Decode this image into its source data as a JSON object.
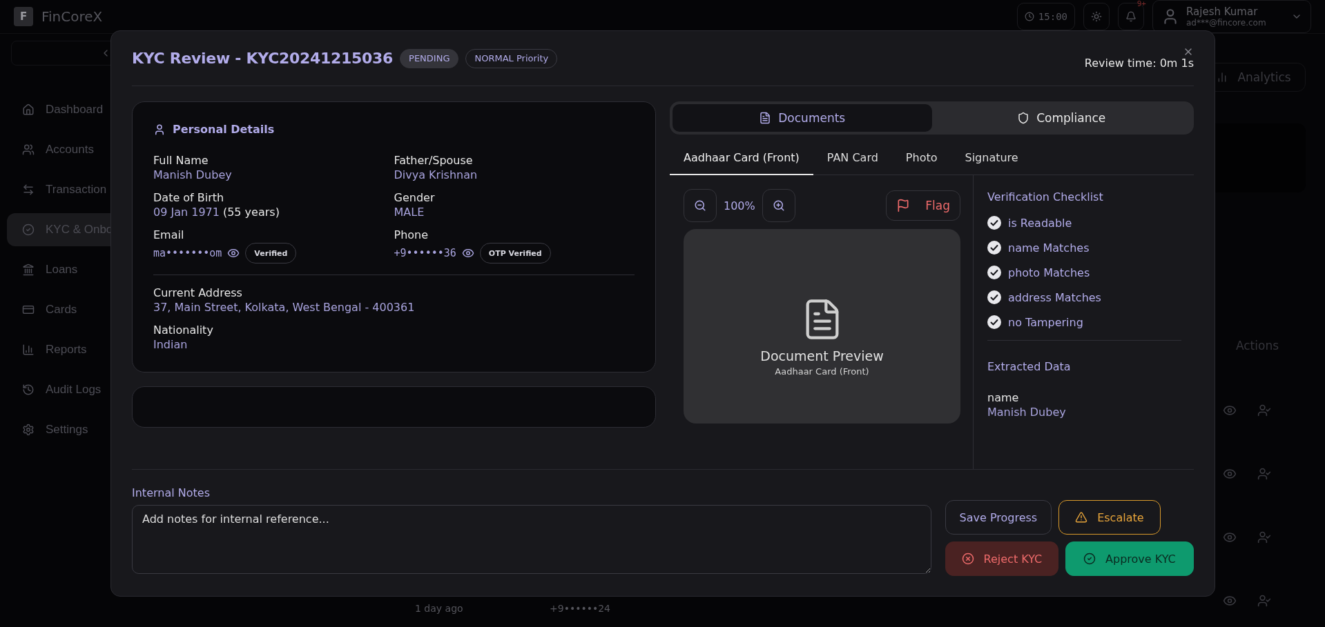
{
  "app": {
    "logo_letter": "F",
    "name": "FinCoreX",
    "clock": "15:00",
    "notification_badge": "9+",
    "user": {
      "name": "Rajesh Kumar",
      "email": "ad***@fincore.com"
    }
  },
  "sidebar": {
    "items": [
      {
        "label": "Dashboard",
        "selected": false
      },
      {
        "label": "Accounts",
        "selected": false
      },
      {
        "label": "Transaction",
        "selected": false
      },
      {
        "label": "KYC & Onbo",
        "selected": true
      },
      {
        "label": "Loans",
        "selected": false
      },
      {
        "label": "Cards",
        "selected": false
      },
      {
        "label": "Reports",
        "selected": false
      },
      {
        "label": "Audit Logs",
        "selected": false
      },
      {
        "label": "Settings",
        "selected": false
      }
    ]
  },
  "background": {
    "analytics_button": "Analytics",
    "actions_header": "Actions",
    "rows": [
      {},
      {},
      {},
      {
        "time": "1 day ago",
        "phone": "+9••••••24"
      }
    ]
  },
  "modal": {
    "title": "KYC Review - KYC20241215036",
    "status": "PENDING",
    "priority": "NORMAL Priority",
    "review_time": "Review time: 0m 1s",
    "personal_details": {
      "title": "Personal Details",
      "fields": [
        {
          "kind": "text",
          "label": "Full Name",
          "value": "Manish Dubey"
        },
        {
          "kind": "text",
          "label": "Father/Spouse",
          "value": "Divya Krishnan"
        },
        {
          "kind": "dob",
          "label": "Date of Birth",
          "value": "09 Jan 1971",
          "suffix": "(55 years)"
        },
        {
          "kind": "text",
          "label": "Gender",
          "value": "MALE"
        },
        {
          "kind": "masked",
          "label": "Email",
          "value": "ma•••••••om",
          "badge": "Verified"
        },
        {
          "kind": "masked",
          "label": "Phone",
          "value": "+9••••••36",
          "badge": "OTP Verified"
        }
      ],
      "address_fields": [
        {
          "label": "Current Address",
          "value": "37, Main Street, Kolkata, West Bengal - 400361"
        },
        {
          "label": "Nationality",
          "value": "Indian"
        }
      ]
    },
    "view_tabs": [
      {
        "label": "Documents",
        "selected": true
      },
      {
        "label": "Compliance",
        "selected": false
      }
    ],
    "doc_tabs": [
      {
        "label": "Aadhaar Card (Front)",
        "selected": true
      },
      {
        "label": "PAN Card",
        "selected": false
      },
      {
        "label": "Photo",
        "selected": false
      },
      {
        "label": "Signature",
        "selected": false
      }
    ],
    "zoom": "100%",
    "flag": "Flag",
    "preview": {
      "title": "Document Preview",
      "subtitle": "Aadhaar Card (Front)"
    },
    "checklist": {
      "title": "Verification Checklist",
      "items": [
        {
          "label": "is Readable",
          "checked": true
        },
        {
          "label": "name Matches",
          "checked": true
        },
        {
          "label": "photo Matches",
          "checked": true
        },
        {
          "label": "address Matches",
          "checked": true
        },
        {
          "label": "no Tampering",
          "checked": true
        }
      ]
    },
    "extracted": {
      "title": "Extracted Data",
      "fields": [
        {
          "label": "name",
          "value": "Manish Dubey"
        }
      ]
    },
    "notes": {
      "label": "Internal Notes",
      "placeholder": "Add notes for internal reference..."
    },
    "actions": [
      {
        "kind": "save",
        "label": "Save Progress"
      },
      {
        "kind": "escalate",
        "label": "Escalate"
      },
      {
        "kind": "reject",
        "label": "Reject KYC"
      },
      {
        "kind": "approve",
        "label": "Approve KYC"
      }
    ]
  }
}
